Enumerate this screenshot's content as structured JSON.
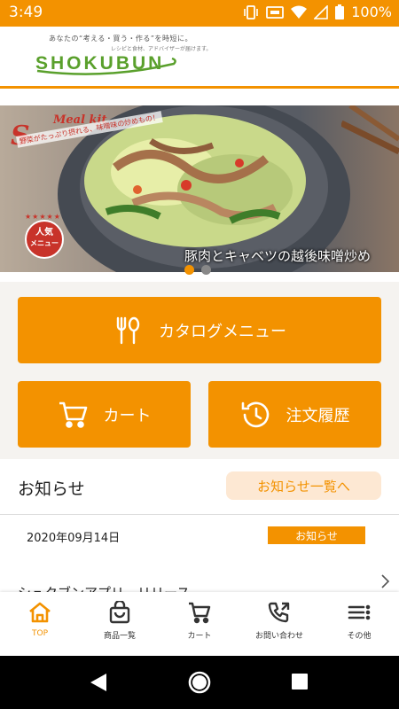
{
  "status_bar": {
    "time": "3:49",
    "battery": "100%"
  },
  "header": {
    "tagline": "あなたの“考える・買う・作る”を時短に。",
    "tagline_sub": "レシピと食材、アドバイザーが届けます。",
    "logo": "SHOKUBUN"
  },
  "banner": {
    "kit_label": "Meal kit",
    "kit_letter": "S",
    "kit_sub": "野菜がたっぷり摂れる、味噌味の炒めもの！",
    "badge": [
      "人気",
      "メニュー"
    ],
    "caption": "豚肉とキャベツの越後味噌炒め",
    "slide_count": 2,
    "active_slide": 1
  },
  "menu": {
    "catalog_label": "カタログメニュー",
    "cart_label": "カート",
    "history_label": "注文履歴"
  },
  "news": {
    "title": "お知らせ",
    "more_label": "お知らせ一覧へ",
    "items": [
      {
        "date": "2020年09月14日",
        "tag": "お知らせ",
        "title": "シュクブンアプリ　リリース"
      }
    ]
  },
  "bottom_nav": [
    {
      "label": "TOP",
      "icon": "home-icon",
      "active": true
    },
    {
      "label": "商品一覧",
      "icon": "bag-icon",
      "active": false
    },
    {
      "label": "カート",
      "icon": "cart-icon",
      "active": false
    },
    {
      "label": "お問い合わせ",
      "icon": "phone-icon",
      "active": false
    },
    {
      "label": "その他",
      "icon": "menu-icon",
      "active": false
    }
  ],
  "colors": {
    "accent": "#f39200",
    "brand_green": "#5aa02c",
    "accent_light": "#fde8d3"
  }
}
